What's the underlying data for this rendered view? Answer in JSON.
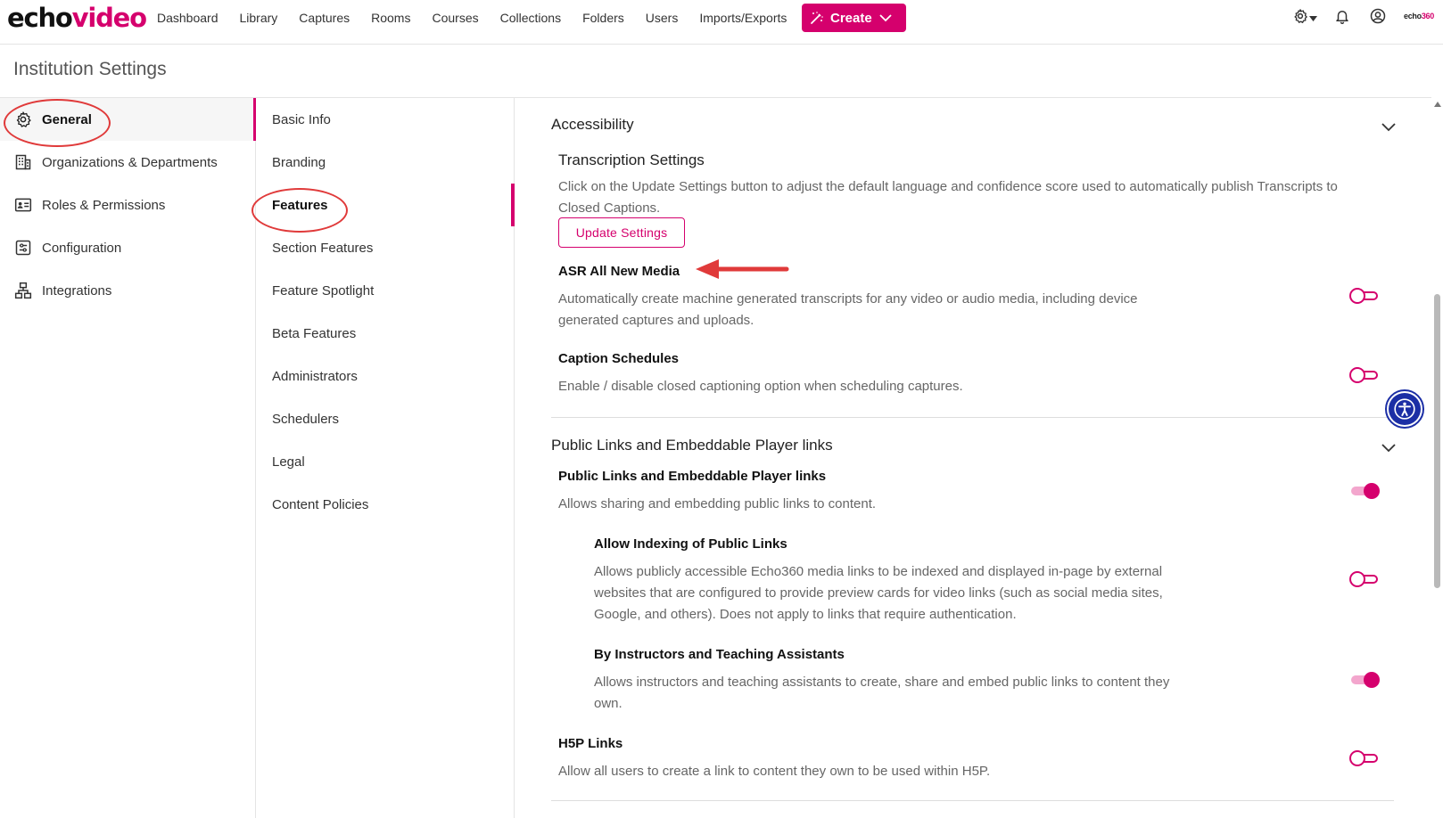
{
  "brand": {
    "logo_part1": "echo",
    "logo_part2": "video",
    "corner_brand_a": "echo",
    "corner_brand_b": "360"
  },
  "nav": {
    "items": [
      {
        "label": "Dashboard"
      },
      {
        "label": "Library"
      },
      {
        "label": "Captures"
      },
      {
        "label": "Rooms"
      },
      {
        "label": "Courses"
      },
      {
        "label": "Collections"
      },
      {
        "label": "Folders"
      },
      {
        "label": "Users"
      },
      {
        "label": "Imports/Exports"
      }
    ],
    "create_label": "Create",
    "icons": [
      "settings-gear-icon",
      "chevron-down-icon",
      "bell-icon",
      "user-circle-icon"
    ]
  },
  "page": {
    "title": "Institution Settings"
  },
  "sidebar": {
    "items": [
      {
        "label": "General",
        "icon": "gear-icon",
        "active": true
      },
      {
        "label": "Organizations & Departments",
        "icon": "building-icon"
      },
      {
        "label": "Roles & Permissions",
        "icon": "id-card-icon"
      },
      {
        "label": "Configuration",
        "icon": "sliders-icon"
      },
      {
        "label": "Integrations",
        "icon": "network-icon"
      }
    ]
  },
  "submenu": {
    "items": [
      {
        "label": "Basic Info"
      },
      {
        "label": "Branding"
      },
      {
        "label": "Features",
        "active": true
      },
      {
        "label": "Section Features"
      },
      {
        "label": "Feature Spotlight"
      },
      {
        "label": "Beta Features"
      },
      {
        "label": "Administrators"
      },
      {
        "label": "Schedulers"
      },
      {
        "label": "Legal"
      },
      {
        "label": "Content Policies"
      }
    ]
  },
  "accessibility": {
    "title": "Accessibility",
    "transcription": {
      "title": "Transcription Settings",
      "desc_line1": "Click on the Update Settings button to adjust the default language and confidence score used to automatically publish Transcripts to",
      "desc_line2": "Closed Captions.",
      "button": "Update Settings"
    },
    "asr": {
      "title": "ASR All New Media",
      "desc_line1": "Automatically create machine generated transcripts for any video or audio media, including device",
      "desc_line2": "generated captures and uploads.",
      "enabled": false
    },
    "caption": {
      "title": "Caption Schedules",
      "desc": "Enable / disable closed captioning option when scheduling captures.",
      "enabled": false
    }
  },
  "public_links": {
    "title": "Public Links and Embeddable Player links",
    "main": {
      "title": "Public Links and Embeddable Player links",
      "desc": "Allows sharing and embedding public links to content.",
      "enabled": true
    },
    "indexing": {
      "title": "Allow Indexing of Public Links",
      "desc_line1": "Allows publicly accessible Echo360 media links to be indexed and displayed in-page by external",
      "desc_line2": "websites that are configured to provide preview cards for video links (such as social media sites,",
      "desc_line3": "Google, and others). Does not apply to links that require authentication.",
      "enabled": false
    },
    "instructors": {
      "title": "By Instructors and Teaching Assistants",
      "desc_line1": "Allows instructors and teaching assistants to create, share and embed public links to content they",
      "desc_line2": "own.",
      "enabled": true
    },
    "h5p": {
      "title": "H5P Links",
      "desc": "Allow all users to create a link to content they own to be used within H5P.",
      "enabled": false
    }
  },
  "colors": {
    "accent": "#d5006d",
    "annotation": "#e03a3a",
    "a11y_widget": "#1b2ea5"
  }
}
